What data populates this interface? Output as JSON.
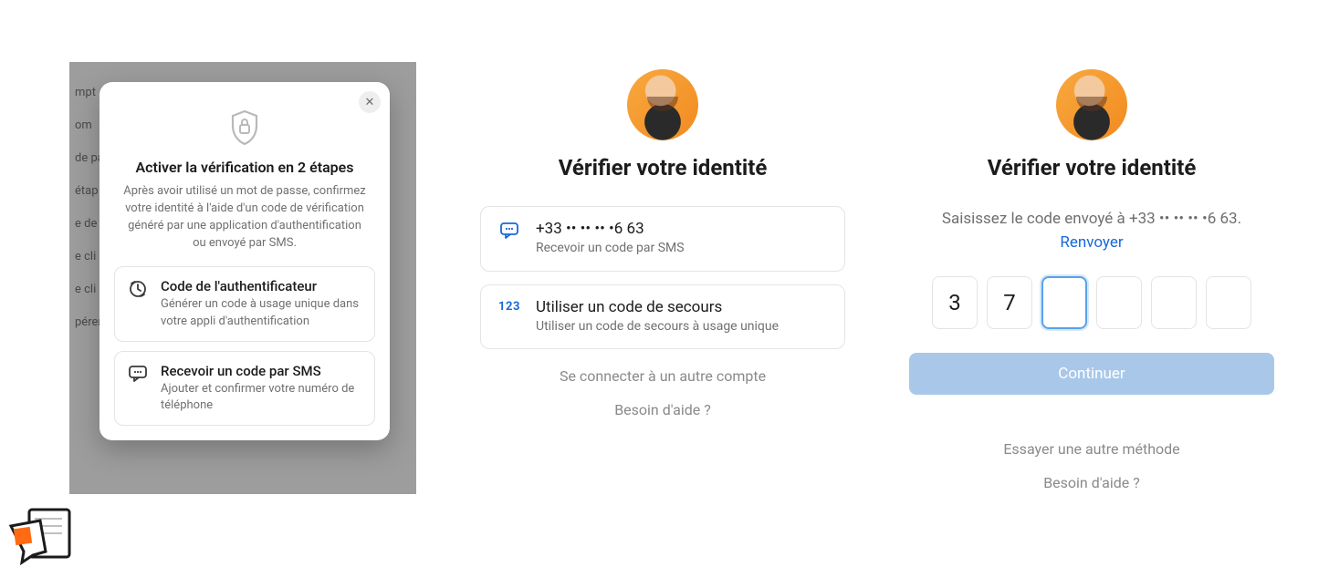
{
  "panel1": {
    "bg_lines": [
      "mpt",
      "om",
      "de pa                                                             pte.",
      "étap",
      "e de                                                         tre c",
      "e cli",
      "e cli                                                        e, afi",
      "pérer du contenu en votre nom. Vous pouvez révoquer l'ac"
    ],
    "modal": {
      "title": "Activer la vérification en 2 étapes",
      "desc": "Après avoir utilisé un mot de passe, confirmez votre identité à l'aide d'un code de vérification généré par une application d'authentification ou envoyé par SMS.",
      "options": [
        {
          "icon": "authenticator",
          "title": "Code de l'authentificateur",
          "sub": "Générer un code à usage unique dans votre appli d'authentification"
        },
        {
          "icon": "sms",
          "title": "Recevoir un code par SMS",
          "sub": "Ajouter et confirmer votre numéro de téléphone"
        }
      ]
    }
  },
  "panel2": {
    "heading": "Vérifier votre identité",
    "choices": [
      {
        "icon": "sms",
        "title": "+33 •• •• •• •6 63",
        "sub": "Recevoir un code par SMS"
      },
      {
        "icon": "123",
        "title": "Utiliser un code de secours",
        "sub": "Utiliser un code de secours à usage unique"
      }
    ],
    "link1": "Se connecter à un autre compte",
    "link2": "Besoin d'aide ?"
  },
  "panel3": {
    "heading": "Vérifier votre identité",
    "desc_prefix": "Saisissez le code envoyé à +33 •• •• •• •6 63. ",
    "resend": "Renvoyer",
    "code": [
      "3",
      "7",
      "",
      "",
      "",
      ""
    ],
    "focused_index": 2,
    "continue": "Continuer",
    "link1": "Essayer une autre méthode",
    "link2": "Besoin d'aide ?"
  }
}
